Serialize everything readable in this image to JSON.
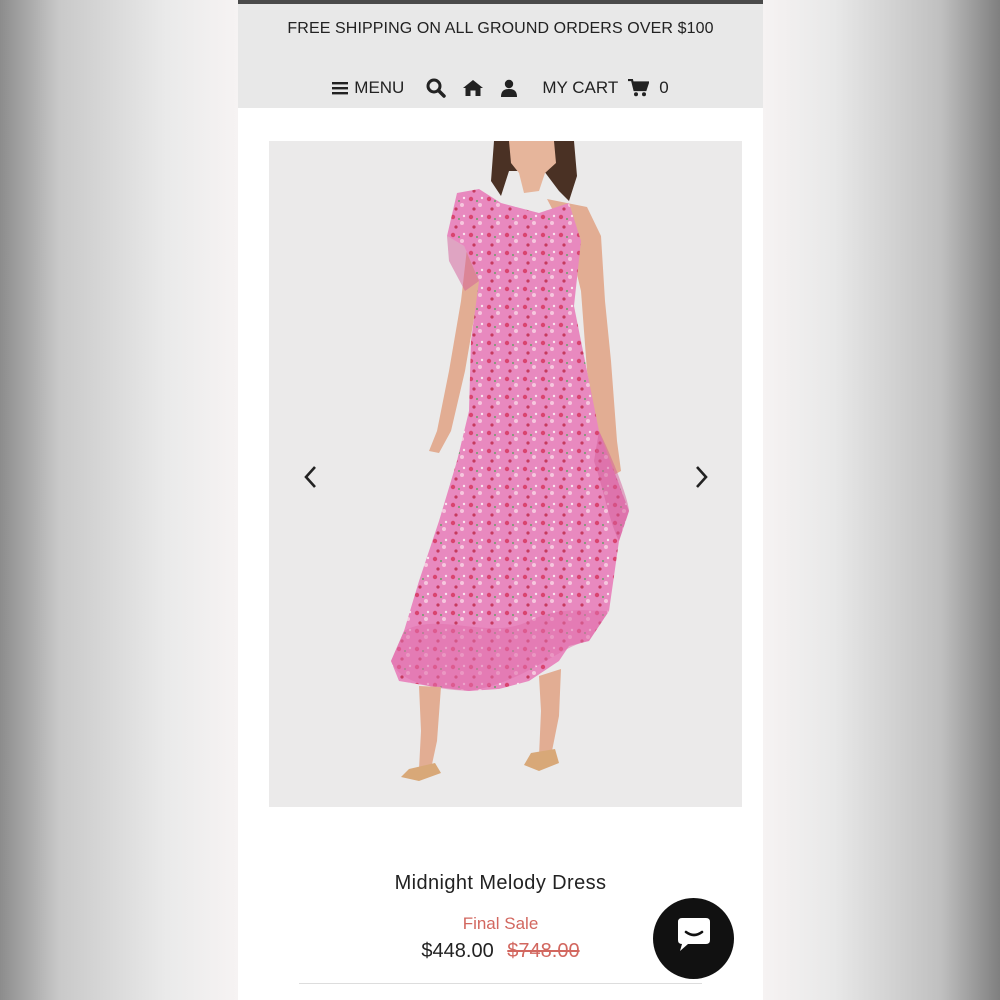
{
  "banner": {
    "shipping_text": "FREE SHIPPING ON ALL GROUND ORDERS OVER $100"
  },
  "nav": {
    "menu_label": "MENU",
    "cart_label": "MY CART",
    "cart_count": "0",
    "icons": [
      "hamburger-icon",
      "search-icon",
      "home-icon",
      "user-icon",
      "cart-icon"
    ]
  },
  "product": {
    "name": "Midnight Melody Dress",
    "sale_label": "Final Sale",
    "price": "$448.00",
    "original_price": "$748.00"
  },
  "colors": {
    "header_bg": "#e8e8e8",
    "sale_red": "#d2675f",
    "dress_pink": "#e97fb7",
    "chat_bg": "#111111"
  }
}
